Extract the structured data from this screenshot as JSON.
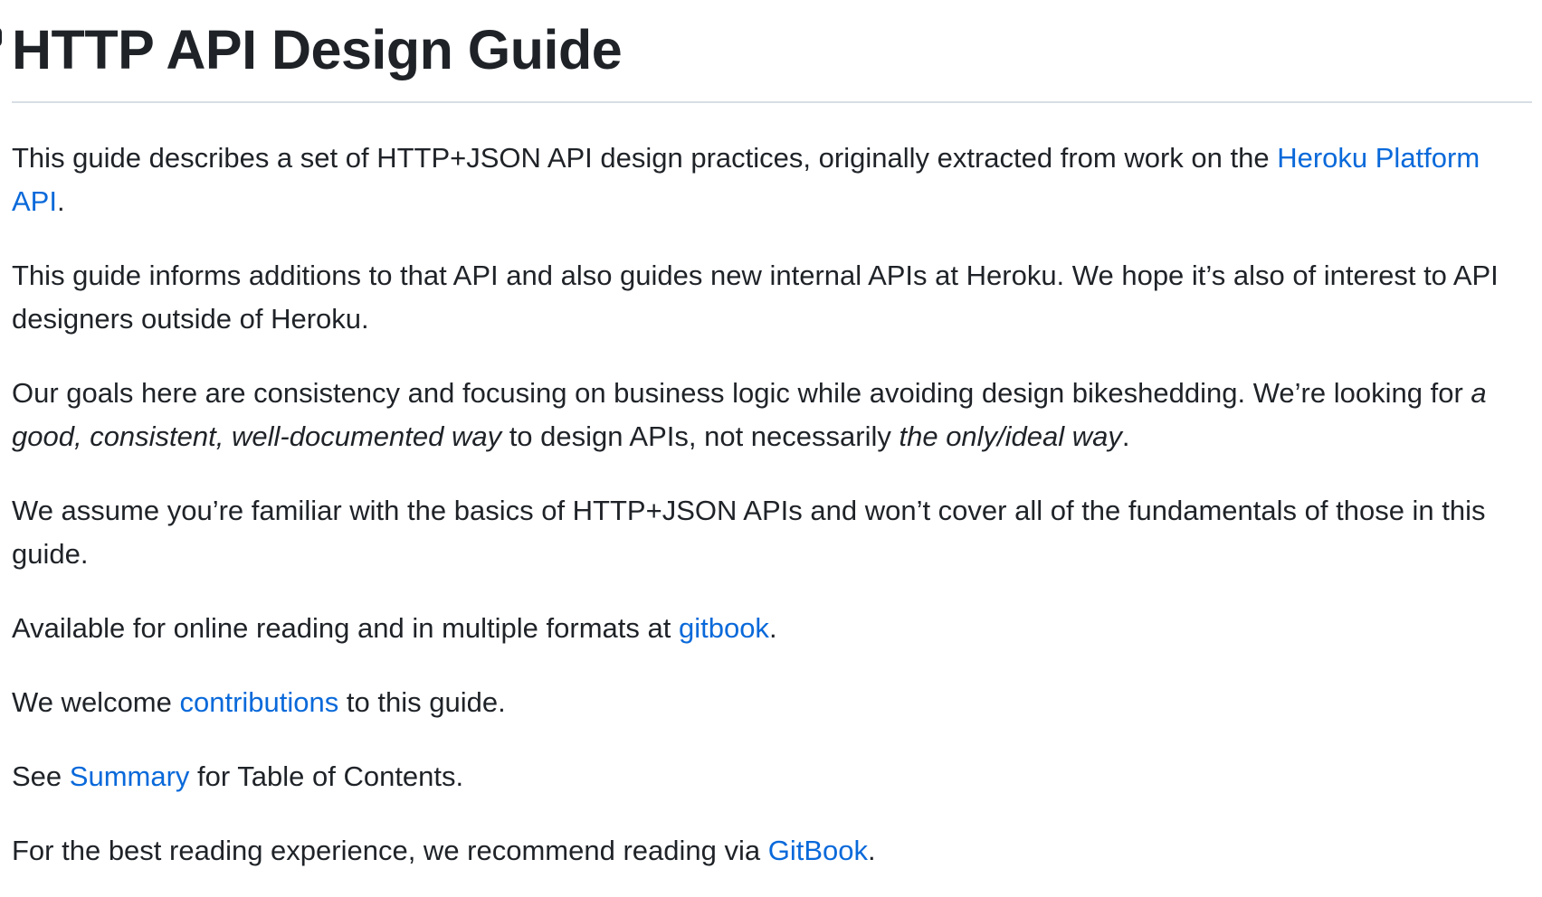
{
  "heading": "HTTP API Design Guide",
  "colors": {
    "text": "#1f2328",
    "link": "#0969da",
    "rule": "#d8dee4"
  },
  "p1": {
    "text": "This guide describes a set of HTTP+JSON API design practices, originally extracted from work on the ",
    "link": "Heroku Platform API",
    "end": "."
  },
  "p2": {
    "text": "This guide informs additions to that API and also guides new internal APIs at Heroku. We hope it’s also of interest to API designers outside of Heroku."
  },
  "p3": {
    "text_a": "Our goals here are consistency and focusing on business logic while avoiding design bikeshedding. We’re looking for ",
    "em_a": "a good, consistent, well-documented way",
    "text_b": " to design APIs, not necessarily ",
    "em_b": "the only/ideal way",
    "end": "."
  },
  "p4": {
    "text": "We assume you’re familiar with the basics of HTTP+JSON APIs and won’t cover all of the fundamentals of those in this guide."
  },
  "p5": {
    "text": "Available for online reading and in multiple formats at ",
    "link": "gitbook",
    "end": "."
  },
  "p6": {
    "text": "We welcome ",
    "link": "contributions",
    "end": " to this guide."
  },
  "p7": {
    "text": "See ",
    "link": "Summary",
    "end": " for Table of Contents."
  },
  "p8": {
    "text": "For the best reading experience, we recommend reading via ",
    "link": "GitBook",
    "end": "."
  }
}
